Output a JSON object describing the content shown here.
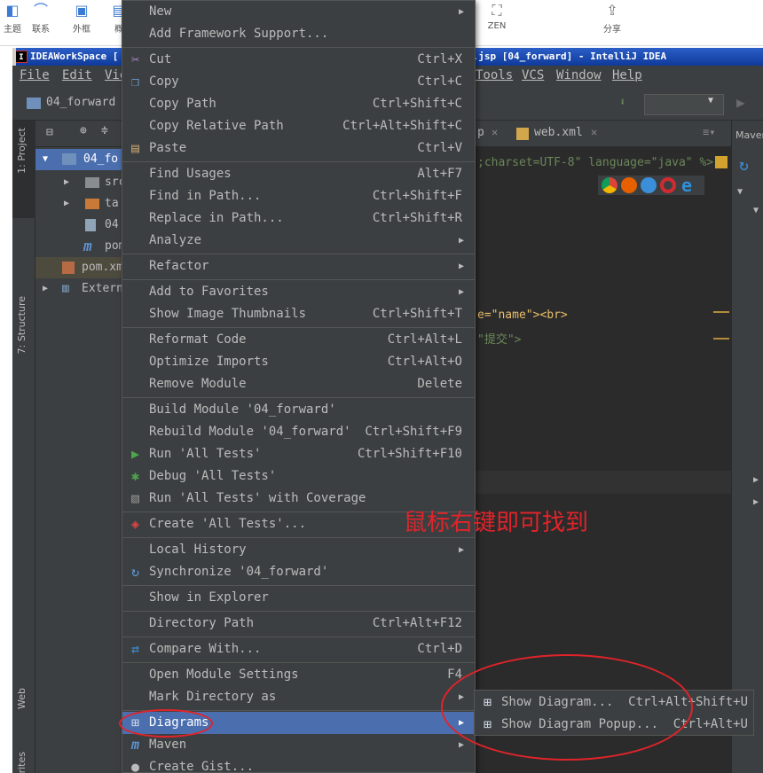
{
  "top_toolbar": {
    "items": [
      {
        "label": "主题"
      },
      {
        "label": "联系"
      },
      {
        "label": "外框"
      },
      {
        "label": "概"
      },
      {
        "label": "ZEN"
      },
      {
        "label": "分享"
      }
    ]
  },
  "window": {
    "title": "IDEAWorkSpace [",
    "title_right": "t.jsp [04_forward] - IntelliJ IDEA"
  },
  "menubar": {
    "left": [
      "File",
      "Edit",
      "Vie"
    ],
    "right": [
      "Tools",
      "VCS",
      "Window",
      "Help"
    ]
  },
  "navbar": {
    "breadcrumb": "04_forward"
  },
  "side_tabs": {
    "project": "1: Project",
    "structure": "7: Structure",
    "web": "Web",
    "favorites": "Favorites"
  },
  "project_tree": {
    "root": "04_fo",
    "items": [
      "src",
      "ta",
      "04",
      "pom",
      "pom.xm",
      "Extern"
    ]
  },
  "editor": {
    "tabs": [
      "p",
      "web.xml"
    ],
    "line1": ";charset=UTF-8\" language=\"java\" %>",
    "line2": "e=\"name\"><br>",
    "line3": "\"提交\">"
  },
  "maven_panel": {
    "label": "Maven"
  },
  "context_menu": {
    "items": [
      {
        "label": "New",
        "shortcut": "",
        "submenu": true,
        "icon": ""
      },
      {
        "label": "Add Framework Support...",
        "shortcut": "",
        "submenu": false,
        "icon": ""
      },
      {
        "label": "Cut",
        "shortcut": "Ctrl+X",
        "submenu": false,
        "icon": "scissors-icon"
      },
      {
        "label": "Copy",
        "shortcut": "Ctrl+C",
        "submenu": false,
        "icon": "copy-icon"
      },
      {
        "label": "Copy Path",
        "shortcut": "Ctrl+Shift+C",
        "submenu": false,
        "icon": ""
      },
      {
        "label": "Copy Relative Path",
        "shortcut": "Ctrl+Alt+Shift+C",
        "submenu": false,
        "icon": ""
      },
      {
        "label": "Paste",
        "shortcut": "Ctrl+V",
        "submenu": false,
        "icon": "paste-icon"
      },
      {
        "label": "Find Usages",
        "shortcut": "Alt+F7",
        "submenu": false,
        "icon": ""
      },
      {
        "label": "Find in Path...",
        "shortcut": "Ctrl+Shift+F",
        "submenu": false,
        "icon": ""
      },
      {
        "label": "Replace in Path...",
        "shortcut": "Ctrl+Shift+R",
        "submenu": false,
        "icon": ""
      },
      {
        "label": "Analyze",
        "shortcut": "",
        "submenu": true,
        "icon": ""
      },
      {
        "label": "Refactor",
        "shortcut": "",
        "submenu": true,
        "icon": ""
      },
      {
        "label": "Add to Favorites",
        "shortcut": "",
        "submenu": true,
        "icon": ""
      },
      {
        "label": "Show Image Thumbnails",
        "shortcut": "Ctrl+Shift+T",
        "submenu": false,
        "icon": ""
      },
      {
        "label": "Reformat Code",
        "shortcut": "Ctrl+Alt+L",
        "submenu": false,
        "icon": ""
      },
      {
        "label": "Optimize Imports",
        "shortcut": "Ctrl+Alt+O",
        "submenu": false,
        "icon": ""
      },
      {
        "label": "Remove Module",
        "shortcut": "Delete",
        "submenu": false,
        "icon": ""
      },
      {
        "label": "Build Module '04_forward'",
        "shortcut": "",
        "submenu": false,
        "icon": ""
      },
      {
        "label": "Rebuild Module '04_forward'",
        "shortcut": "Ctrl+Shift+F9",
        "submenu": false,
        "icon": ""
      },
      {
        "label": "Run 'All Tests'",
        "shortcut": "Ctrl+Shift+F10",
        "submenu": false,
        "icon": "run-icon"
      },
      {
        "label": "Debug 'All Tests'",
        "shortcut": "",
        "submenu": false,
        "icon": "debug-icon"
      },
      {
        "label": "Run 'All Tests' with Coverage",
        "shortcut": "",
        "submenu": false,
        "icon": "coverage-icon"
      },
      {
        "label": "Create 'All Tests'...",
        "shortcut": "",
        "submenu": false,
        "icon": "create-test-icon"
      },
      {
        "label": "Local History",
        "shortcut": "",
        "submenu": true,
        "icon": ""
      },
      {
        "label": "Synchronize '04_forward'",
        "shortcut": "",
        "submenu": false,
        "icon": "sync-icon"
      },
      {
        "label": "Show in Explorer",
        "shortcut": "",
        "submenu": false,
        "icon": ""
      },
      {
        "label": "Directory Path",
        "shortcut": "Ctrl+Alt+F12",
        "submenu": false,
        "icon": ""
      },
      {
        "label": "Compare With...",
        "shortcut": "Ctrl+D",
        "submenu": false,
        "icon": "compare-icon"
      },
      {
        "label": "Open Module Settings",
        "shortcut": "F4",
        "submenu": false,
        "icon": ""
      },
      {
        "label": "Mark Directory as",
        "shortcut": "",
        "submenu": true,
        "icon": ""
      },
      {
        "label": "Diagrams",
        "shortcut": "",
        "submenu": true,
        "icon": "diagram-icon",
        "selected": true
      },
      {
        "label": "Maven",
        "shortcut": "",
        "submenu": true,
        "icon": "maven-icon"
      },
      {
        "label": "Create Gist...",
        "shortcut": "",
        "submenu": false,
        "icon": "gist-icon"
      }
    ]
  },
  "submenu": {
    "items": [
      {
        "label": "Show Diagram...",
        "shortcut": "Ctrl+Alt+Shift+U"
      },
      {
        "label": "Show Diagram Popup...",
        "shortcut": "Ctrl+Alt+U"
      }
    ]
  },
  "annotation": {
    "text": "鼠标右键即可找到",
    "color": "#e0242a"
  },
  "colors": {
    "menu_bg": "#3c3f41",
    "selection": "#4b6eaf",
    "editor_bg": "#2b2b2b",
    "title_bar": "#0f3a9a"
  }
}
